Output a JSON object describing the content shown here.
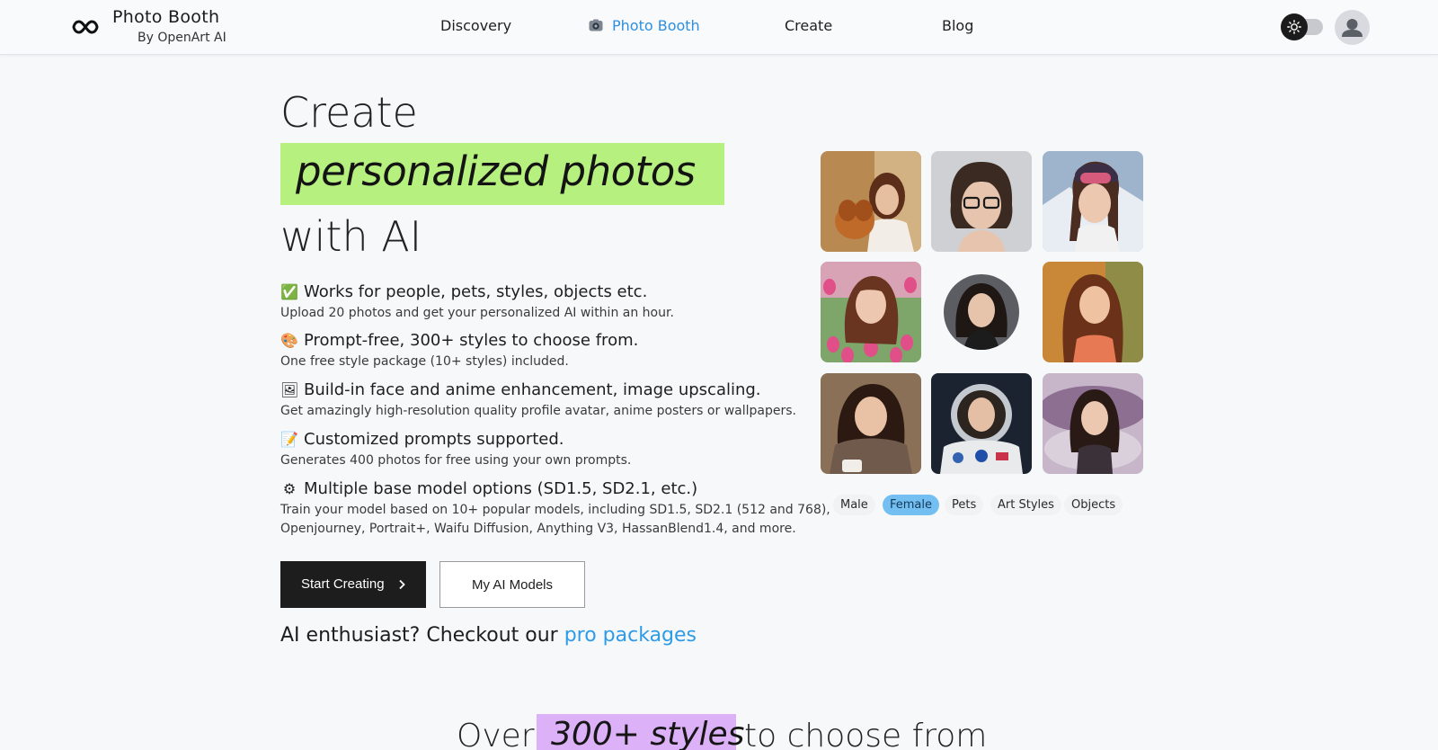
{
  "header": {
    "brand_title": "Photo Booth",
    "brand_sub": "By OpenArt AI",
    "nav": [
      {
        "label": "Discovery",
        "active": false
      },
      {
        "label": "Photo Booth",
        "active": true
      },
      {
        "label": "Create",
        "active": false
      },
      {
        "label": "Blog",
        "active": false
      }
    ],
    "icons": [
      "infinity-logo-icon",
      "camera-icon",
      "sun-icon",
      "user-avatar-icon"
    ]
  },
  "hero": {
    "line1": "Create",
    "highlight": "personalized photos",
    "line3": "with AI",
    "highlight_color": "#b6f07e"
  },
  "features": [
    {
      "emoji": "✅",
      "title": "Works for people, pets, styles, objects etc.",
      "desc": "Upload 20 photos and get your personalized AI within an hour."
    },
    {
      "emoji": "🎨",
      "title": "Prompt-free, 300+ styles to choose from.",
      "desc": "One free style package (10+ styles) included."
    },
    {
      "emoji": "🖼",
      "title": "Build-in face and anime enhancement, image upscaling.",
      "desc": "Get amazingly high-resolution quality profile avatar, anime posters or wallpapers."
    },
    {
      "emoji": "📝",
      "title": "Customized prompts supported.",
      "desc": "Generates 400 photos for free using your own prompts."
    },
    {
      "emoji": "⚙",
      "title": "Multiple base model options (SD1.5, SD2.1, etc.)",
      "desc": "Train your model based on 10+ popular models, including SD1.5, SD2.1 (512 and 768),",
      "desc2": "Openjourney, Portrait+, Waifu Diffusion, Anything V3, HassanBlend1.4, and more."
    }
  ],
  "buttons": {
    "start": "Start Creating",
    "models": "My AI Models"
  },
  "pro": {
    "text": "AI enthusiast? Checkout our",
    "link": "pro packages"
  },
  "categories": [
    {
      "label": "Male",
      "active": false
    },
    {
      "label": "Female",
      "active": true
    },
    {
      "label": "Pets",
      "active": false
    },
    {
      "label": "Art Styles",
      "active": false
    },
    {
      "label": "Objects",
      "active": false
    }
  ],
  "styles_heading": {
    "pre": "Over",
    "highlight": "300+ styles",
    "post": "to choose from",
    "highlight_color": "#dcb1f7"
  },
  "colors": {
    "accent": "#2e8fe0",
    "link": "#2e9be6",
    "chip_active": "#73bff2"
  }
}
